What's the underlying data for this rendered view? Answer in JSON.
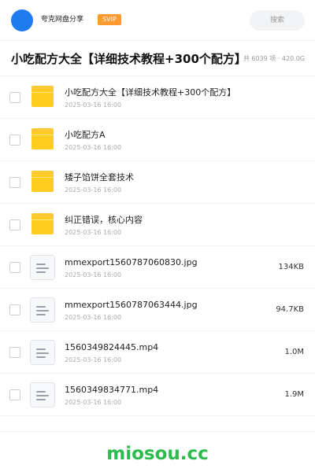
{
  "header": {
    "share_name": "夸克网盘分享",
    "badge": "SVIP",
    "search_placeholder": "搜索",
    "avatar_color": "#1e7bf0",
    "badge_color": "#ff9a2e"
  },
  "folder": {
    "title": "小吃配方大全【详细技术教程+300个配方】",
    "summary": "共 6039 项 · 420.0G"
  },
  "files": [
    {
      "type": "folder",
      "icon": "folder-icon",
      "name": "小吃配方大全【详细技术教程+300个配方】",
      "date": "2025-03-16 16:00",
      "size": ""
    },
    {
      "type": "folder",
      "icon": "folder-icon",
      "name": "小吃配方A",
      "date": "2025-03-16 16:00",
      "size": ""
    },
    {
      "type": "folder",
      "icon": "folder-icon",
      "name": "矮子馅饼全套技术",
      "date": "2025-03-16 16:00",
      "size": ""
    },
    {
      "type": "folder",
      "icon": "folder-icon",
      "name": "纠正错误，核心内容",
      "date": "2025-03-16 16:00",
      "size": ""
    },
    {
      "type": "file",
      "icon": "document-icon",
      "name": "mmexport1560787060830.jpg",
      "date": "2025-03-16 16:00",
      "size": "134KB"
    },
    {
      "type": "file",
      "icon": "document-icon",
      "name": "mmexport1560787063444.jpg",
      "date": "2025-03-16 16:00",
      "size": "94.7KB"
    },
    {
      "type": "file",
      "icon": "document-icon",
      "name": "1560349824445.mp4",
      "date": "2025-03-16 16:00",
      "size": "1.0M"
    },
    {
      "type": "file",
      "icon": "document-icon",
      "name": "1560349834771.mp4",
      "date": "2025-03-16 16:00",
      "size": "1.9M"
    }
  ],
  "footer": {
    "brand": "miosou.cc",
    "brand_color": "#2dbb4e"
  }
}
